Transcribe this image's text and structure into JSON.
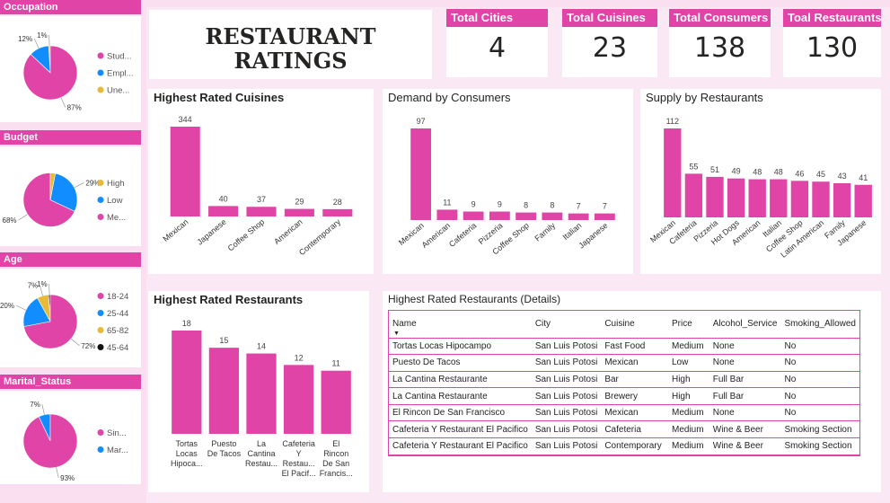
{
  "title": {
    "line1": "RESTAURANT",
    "line2": "RATINGS"
  },
  "kpis": [
    {
      "label": "Total Cities",
      "value": "4"
    },
    {
      "label": "Total Cuisines",
      "value": "23"
    },
    {
      "label": "Total Consumers",
      "value": "138"
    },
    {
      "label": "Toal Restaurants",
      "value": "130"
    }
  ],
  "colors": {
    "accent": "#e044a7",
    "blue": "#118dff",
    "yellow": "#e8b93b",
    "black": "#111111"
  },
  "sidebar": [
    {
      "title": "Occupation",
      "slices": [
        {
          "label": "Stud...",
          "value": 87,
          "pct": "87%",
          "color": "#e044a7"
        },
        {
          "label": "Empl...",
          "value": 12,
          "pct": "12%",
          "color": "#118dff"
        },
        {
          "label": "Une...",
          "value": 1,
          "pct": "1%",
          "color": "#e8b93b"
        }
      ]
    },
    {
      "title": "Budget",
      "slices": [
        {
          "label": "High",
          "value": 3,
          "pct": "",
          "color": "#e8b93b"
        },
        {
          "label": "Low",
          "value": 29,
          "pct": "29%",
          "color": "#118dff"
        },
        {
          "label": "Me...",
          "value": 68,
          "pct": "68%",
          "color": "#e044a7"
        }
      ]
    },
    {
      "title": "Age",
      "slices": [
        {
          "label": "18-24",
          "value": 72,
          "pct": "72%",
          "color": "#e044a7"
        },
        {
          "label": "25-44",
          "value": 20,
          "pct": "20%",
          "color": "#118dff"
        },
        {
          "label": "65-82",
          "value": 7,
          "pct": "7%",
          "color": "#e8b93b"
        },
        {
          "label": "45-64",
          "value": 1,
          "pct": "1%",
          "color": "#111111"
        }
      ]
    },
    {
      "title": "Marital_Status",
      "slices": [
        {
          "label": "Sin...",
          "value": 93,
          "pct": "93%",
          "color": "#e044a7"
        },
        {
          "label": "Mar...",
          "value": 7,
          "pct": "7%",
          "color": "#118dff"
        }
      ]
    }
  ],
  "charts": {
    "cuisines": {
      "title": "Highest Rated Cuisines",
      "type": "bar",
      "categories": [
        "Mexican",
        "Japanese",
        "Coffee Shop",
        "American",
        "Contemporary"
      ],
      "values": [
        344,
        40,
        37,
        29,
        28
      ]
    },
    "demand": {
      "title": "Demand by Consumers",
      "type": "bar",
      "categories": [
        "Mexican",
        "American",
        "Cafeteria",
        "Pizzeria",
        "Coffee Shop",
        "Family",
        "Italian",
        "Japanese"
      ],
      "values": [
        97,
        11,
        9,
        9,
        8,
        8,
        7,
        7
      ]
    },
    "supply": {
      "title": "Supply by Restaurants",
      "type": "bar",
      "categories": [
        "Mexican",
        "Cafeteria",
        "Pizzeria",
        "Hot Dogs",
        "American",
        "Italian",
        "Coffee Shop",
        "Latin American",
        "Family",
        "Japanese"
      ],
      "values": [
        112,
        55,
        51,
        49,
        48,
        48,
        46,
        45,
        43,
        41
      ]
    },
    "restaurants": {
      "title": "Highest Rated Restaurants",
      "type": "bar",
      "categories": [
        [
          "Tortas",
          "Locas",
          "Hipoca..."
        ],
        [
          "Puesto",
          "De Tacos"
        ],
        [
          "La",
          "Cantina",
          "Restau..."
        ],
        [
          "Cafeteria",
          "Y",
          "Restau...",
          "El Pacif..."
        ],
        [
          "El",
          "Rincon",
          "De San",
          "Francis..."
        ]
      ],
      "values": [
        18,
        15,
        14,
        12,
        11
      ]
    }
  },
  "details": {
    "title": "Highest Rated Restaurants (Details)",
    "columns": [
      "Name",
      "City",
      "Cuisine",
      "Price",
      "Alcohol_Service",
      "Smoking_Allowed"
    ],
    "rows": [
      [
        "Tortas Locas Hipocampo",
        "San Luis Potosi",
        "Fast Food",
        "Medium",
        "None",
        "No"
      ],
      [
        "Puesto De Tacos",
        "San Luis Potosi",
        "Mexican",
        "Low",
        "None",
        "No"
      ],
      [
        "La Cantina Restaurante",
        "San Luis Potosi",
        "Bar",
        "High",
        "Full Bar",
        "No"
      ],
      [
        "La Cantina Restaurante",
        "San Luis Potosi",
        "Brewery",
        "High",
        "Full Bar",
        "No"
      ],
      [
        "El Rincon De San Francisco",
        "San Luis Potosi",
        "Mexican",
        "Medium",
        "None",
        "No"
      ],
      [
        "Cafeteria Y Restaurant El Pacifico",
        "San Luis Potosi",
        "Cafeteria",
        "Medium",
        "Wine & Beer",
        "Smoking Section"
      ],
      [
        "Cafeteria Y Restaurant El Pacifico",
        "San Luis Potosi",
        "Contemporary",
        "Medium",
        "Wine & Beer",
        "Smoking Section"
      ]
    ]
  },
  "chart_data": [
    {
      "type": "pie",
      "title": "Occupation",
      "labels": [
        "Stud...",
        "Empl...",
        "Une..."
      ],
      "values": [
        87,
        12,
        1
      ]
    },
    {
      "type": "pie",
      "title": "Budget",
      "labels": [
        "High",
        "Low",
        "Me..."
      ],
      "values": [
        3,
        29,
        68
      ]
    },
    {
      "type": "pie",
      "title": "Age",
      "labels": [
        "18-24",
        "25-44",
        "65-82",
        "45-64"
      ],
      "values": [
        72,
        20,
        7,
        1
      ]
    },
    {
      "type": "pie",
      "title": "Marital_Status",
      "labels": [
        "Sin...",
        "Mar..."
      ],
      "values": [
        93,
        7
      ]
    },
    {
      "type": "bar",
      "title": "Highest Rated Cuisines",
      "categories": [
        "Mexican",
        "Japanese",
        "Coffee Shop",
        "American",
        "Contemporary"
      ],
      "values": [
        344,
        40,
        37,
        29,
        28
      ]
    },
    {
      "type": "bar",
      "title": "Demand by Consumers",
      "categories": [
        "Mexican",
        "American",
        "Cafeteria",
        "Pizzeria",
        "Coffee Shop",
        "Family",
        "Italian",
        "Japanese"
      ],
      "values": [
        97,
        11,
        9,
        9,
        8,
        8,
        7,
        7
      ]
    },
    {
      "type": "bar",
      "title": "Supply by Restaurants",
      "categories": [
        "Mexican",
        "Cafeteria",
        "Pizzeria",
        "Hot Dogs",
        "American",
        "Italian",
        "Coffee Shop",
        "Latin American",
        "Family",
        "Japanese"
      ],
      "values": [
        112,
        55,
        51,
        49,
        48,
        48,
        46,
        45,
        43,
        41
      ]
    },
    {
      "type": "bar",
      "title": "Highest Rated Restaurants",
      "categories": [
        "Tortas Locas Hipoca...",
        "Puesto De Tacos",
        "La Cantina Restau...",
        "Cafeteria Y Restau... El Pacif...",
        "El Rincon De San Francis..."
      ],
      "values": [
        18,
        15,
        14,
        12,
        11
      ]
    }
  ]
}
